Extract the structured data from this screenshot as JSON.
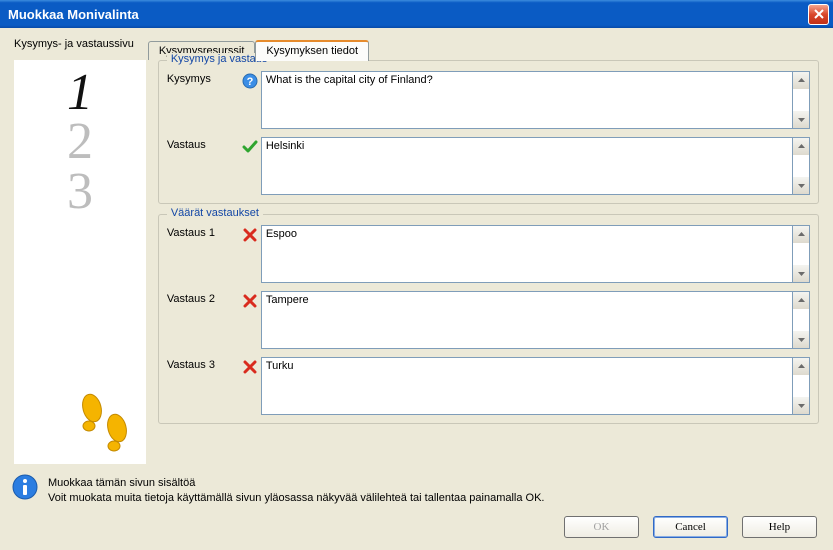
{
  "window": {
    "title": "Muokkaa Monivalinta"
  },
  "tabs": {
    "sidebar_label": "Kysymys- ja vastaussivu",
    "t1": "Kysymysresurssit",
    "t2": "Kysymyksen tiedot"
  },
  "group_qa": {
    "legend": "Kysymys ja vastaus",
    "question_label": "Kysymys",
    "question_value": "What is the capital city of Finland?",
    "answer_label": "Vastaus",
    "answer_value": "Helsinki"
  },
  "group_wrong": {
    "legend": "Väärät vastaukset",
    "a1_label": "Vastaus 1",
    "a1_value": "Espoo",
    "a2_label": "Vastaus 2",
    "a2_value": "Tampere",
    "a3_label": "Vastaus 3",
    "a3_value": "Turku"
  },
  "hint": {
    "line1": "Muokkaa tämän sivun sisältöä",
    "line2": "Voit muokata muita tietoja käyttämällä sivun yläosassa näkyvää välilehteä tai tallentaa painamalla OK."
  },
  "buttons": {
    "ok": "OK",
    "cancel": "Cancel",
    "help": "Help"
  }
}
